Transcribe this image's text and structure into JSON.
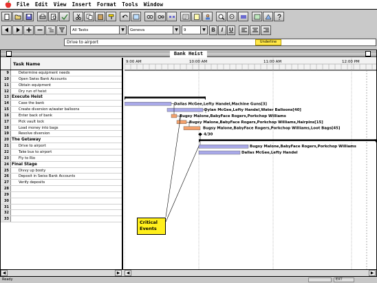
{
  "menubar": {
    "items": [
      "File",
      "Edit",
      "View",
      "Insert",
      "Format",
      "Tools",
      "Window"
    ]
  },
  "toolbar2": {
    "filter_value": "All Tasks",
    "font_value": "Geneva",
    "size_value": "9"
  },
  "entry_bar": {
    "value": "Drive to airport",
    "tag": "Underline"
  },
  "window": {
    "title": "Bank Heist"
  },
  "table": {
    "header": "Task Name",
    "rows": [
      {
        "num": "9",
        "name": "Determine equipment needs",
        "kind": "sub"
      },
      {
        "num": "10",
        "name": "Open Swiss Bank Accounts",
        "kind": "sub"
      },
      {
        "num": "11",
        "name": "Obtain equipment",
        "kind": "sub"
      },
      {
        "num": "12",
        "name": "Dry run of heist",
        "kind": "sub"
      },
      {
        "num": "13",
        "name": "Execute Heist",
        "kind": "summary"
      },
      {
        "num": "14",
        "name": "Case the bank",
        "kind": "sub"
      },
      {
        "num": "15",
        "name": "Create diversion w/water balloons",
        "kind": "sub"
      },
      {
        "num": "16",
        "name": "Enter back of bank",
        "kind": "sub"
      },
      {
        "num": "17",
        "name": "Pick vault lock",
        "kind": "sub"
      },
      {
        "num": "18",
        "name": "Load money into bags",
        "kind": "sub"
      },
      {
        "num": "19",
        "name": "Resolve diversion",
        "kind": "sub"
      },
      {
        "num": "20",
        "name": "The Getaway",
        "kind": "summary"
      },
      {
        "num": "21",
        "name": "Drive to airport",
        "kind": "sub"
      },
      {
        "num": "22",
        "name": "Take bus to airport",
        "kind": "sub"
      },
      {
        "num": "23",
        "name": "Fly to Rio",
        "kind": "sub"
      },
      {
        "num": "24",
        "name": "Final Stage",
        "kind": "summary"
      },
      {
        "num": "25",
        "name": "Divvy up booty",
        "kind": "sub"
      },
      {
        "num": "26",
        "name": "Deposit in Swiss Bank Accounts",
        "kind": "sub"
      },
      {
        "num": "27",
        "name": "Verify deposits",
        "kind": "sub"
      },
      {
        "num": "28",
        "name": "",
        "kind": "sub"
      },
      {
        "num": "29",
        "name": "",
        "kind": "sub"
      },
      {
        "num": "30",
        "name": "",
        "kind": "sub"
      },
      {
        "num": "31",
        "name": "",
        "kind": "sub"
      },
      {
        "num": "32",
        "name": "",
        "kind": "sub"
      },
      {
        "num": "33",
        "name": "",
        "kind": "sub"
      }
    ]
  },
  "gantt": {
    "time_labels": [
      "9:00 AM",
      "10:00 AM",
      "11:00 AM",
      "12:00 PM"
    ],
    "bar_labels": [
      {
        "row": 5,
        "text": "Dallas McGee,Lefty Handel,Machine Guns[3]"
      },
      {
        "row": 6,
        "text": "Dylan McGee,Lefty Handel,Water Balloons[40]"
      },
      {
        "row": 7,
        "text": "Bugsy Malone,BabyFace Rogers,Porkchop Williams"
      },
      {
        "row": 8,
        "text": "Bugsy Malone,BabyFace Rogers,Porkchop Williams,Hairpins[15]"
      },
      {
        "row": 9,
        "text": "Bugsy Malone,BabyFace Rogers,Porkchop Williams,Loot Bags[45]"
      },
      {
        "row": 10,
        "text": "4/30"
      },
      {
        "row": 12,
        "text": "Bugsy Malone,BabyFace Rogers,Porkchop Williams"
      },
      {
        "row": 13,
        "text": "Dallas McGee,Lefty Handel"
      }
    ],
    "callout": "Critical Events",
    "colors": {
      "normal_bar": "#a9a9e8",
      "critical_bar": "#f2a06c",
      "summary_bar": "#000000",
      "callout_fill": "#ffef1c"
    }
  },
  "status": {
    "text": "Ready",
    "box": "EXT"
  }
}
